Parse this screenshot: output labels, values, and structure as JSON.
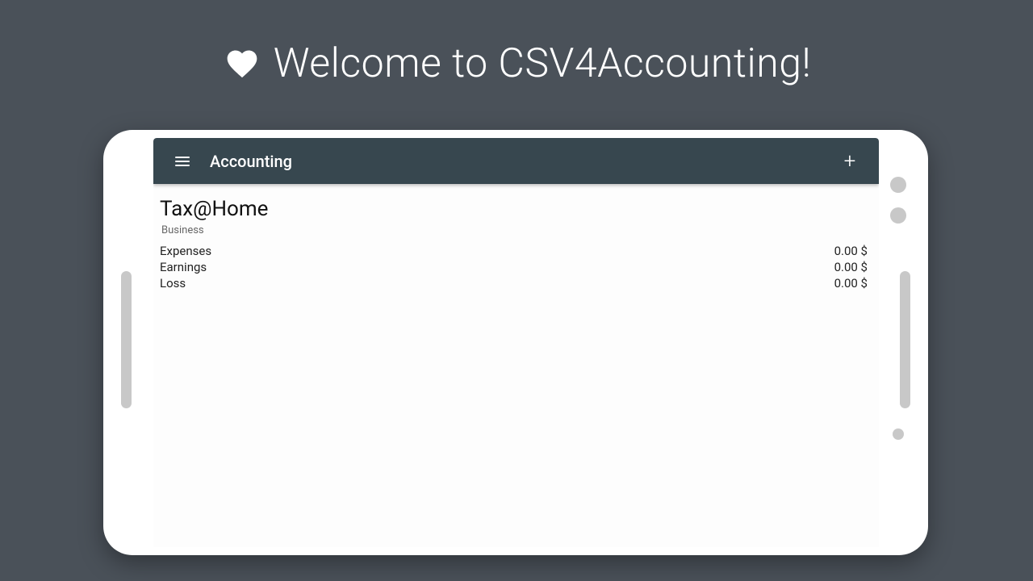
{
  "hero": {
    "title": "Welcome to CSV4Accounting!",
    "icon": "heart-icon"
  },
  "appbar": {
    "title": "Accounting",
    "menu_icon": "menu-icon",
    "add_icon": "plus-icon"
  },
  "document": {
    "title": "Tax@Home",
    "subtitle": "Business",
    "rows": [
      {
        "label": "Expenses",
        "value": "0.00 $"
      },
      {
        "label": "Earnings",
        "value": "0.00 $"
      },
      {
        "label": "Loss",
        "value": "0.00 $"
      }
    ]
  }
}
